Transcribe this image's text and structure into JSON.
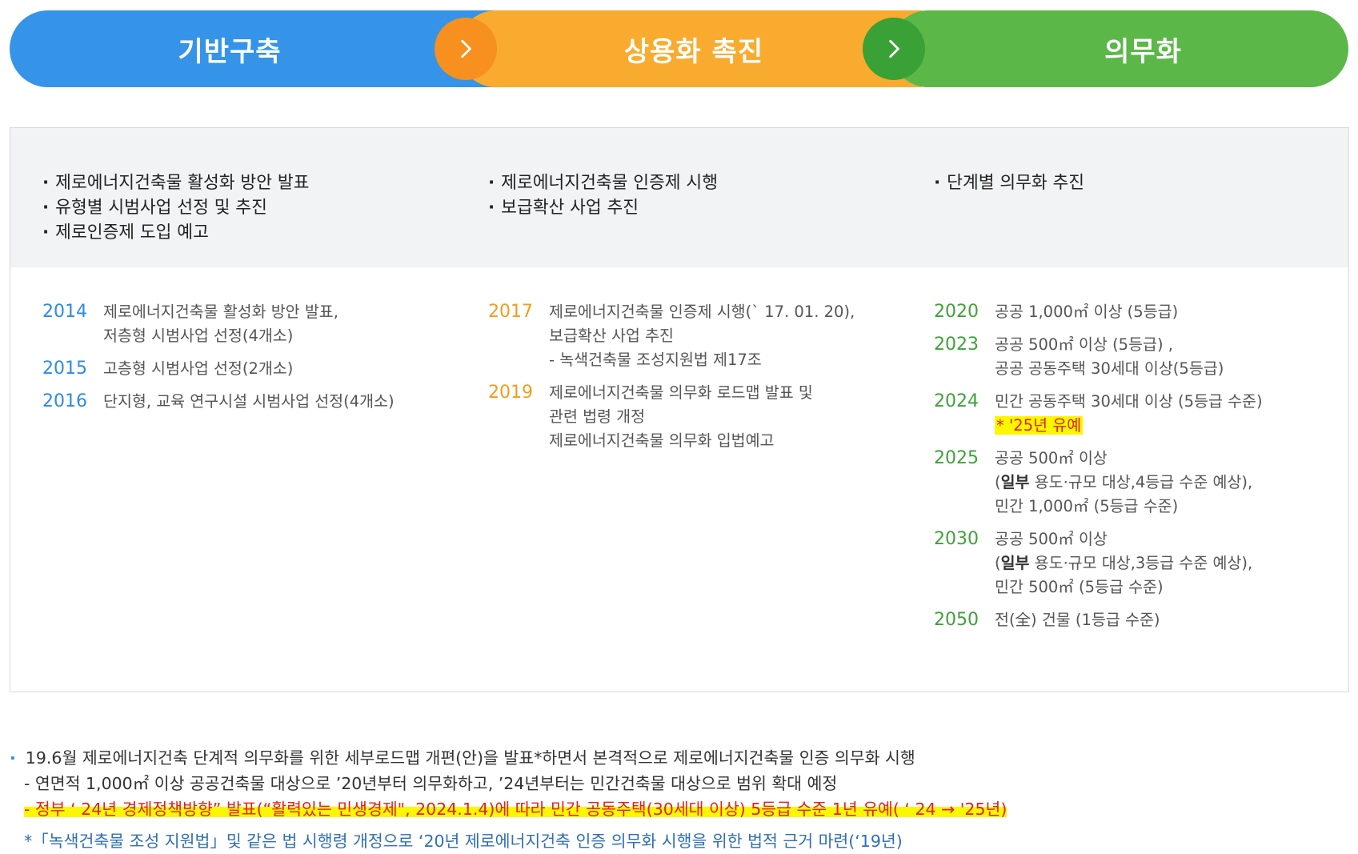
{
  "phases": [
    {
      "label": "기반구축",
      "color": "#3594e8"
    },
    {
      "label": "상용화 촉진",
      "color": "#f9ab2f"
    },
    {
      "label": "의무화",
      "color": "#5bb848"
    }
  ],
  "summary": {
    "col1": [
      "제로에너지건축물 활성화 방안 발표",
      "유형별 시범사업 선정 및 추진",
      "제로인증제 도입 예고"
    ],
    "col2": [
      "제로에너지건축물 인증제 시행",
      "보급확산 사업 추진"
    ],
    "col3": [
      "단계별 의무화 추진"
    ]
  },
  "timeline": {
    "col1": [
      {
        "year": "2014",
        "lines": [
          "제로에너지건축물 활성화 방안 발표,",
          "저층형 시범사업 선정(4개소)"
        ]
      },
      {
        "year": "2015",
        "lines": [
          "고층형 시범사업 선정(2개소)"
        ]
      },
      {
        "year": "2016",
        "lines": [
          "단지형, 교육 연구시설 시범사업 선정(4개소)"
        ]
      }
    ],
    "col2": [
      {
        "year": "2017",
        "lines": [
          "제로에너지건축물 인증제 시행(` 17. 01. 20),",
          "보급확산 사업 추진",
          "- 녹색건축물 조성지원법 제17조"
        ]
      },
      {
        "year": "2019",
        "lines": [
          "제로에너지건축물 의무화 로드맵 발표 및",
          "관련 법령 개정",
          "제로에너지건축물 의무화 입법예고"
        ]
      }
    ],
    "col3": [
      {
        "year": "2020",
        "lines": [
          "공공 1,000㎡ 이상 (5등급)"
        ]
      },
      {
        "year": "2023",
        "lines": [
          "공공 500㎡ 이상 (5등급) ,",
          "공공 공동주택 30세대 이상(5등급)"
        ]
      },
      {
        "year": "2024",
        "lines": [
          "민간 공동주택 30세대 이상 (5등급 수준)"
        ],
        "note": "* '25년 유예"
      },
      {
        "year": "2025",
        "lines": [
          "공공 500㎡ 이상"
        ],
        "bold": "일부",
        "rest": " 용도·규모 대상,4등급 수준 예상),",
        "last": "민간 1,000㎡ (5등급 수준)"
      },
      {
        "year": "2030",
        "lines": [
          "공공 500㎡ 이상"
        ],
        "bold": "일부",
        "rest": " 용도·규모 대상,3등급 수준 예상),",
        "last": "민간 500㎡ (5등급 수준)"
      },
      {
        "year": "2050",
        "lines": [
          "전(全) 건물 (1등급 수준)"
        ]
      }
    ]
  },
  "notes": {
    "main": "19.6월 제로에너지건축 단계적 의무화를 위한 세부로드맵 개편(안)을 발표*하면서 본격적으로 제로에너지건축물 인증 의무화 시행",
    "sub": "- 연면적 1,000㎡ 이상 공공건축물 대상으로 ’20년부터 의무화하고, ’24년부터는 민간건축물 대상으로 범위 확대 예정",
    "highlight": "- 정부 ‘ 24년 경제정책방향” 발표(“활력있는 민생경제\", 2024.1.4)에 따라 민간 공동주택(30세대 이상) 5등급 수준 1년 유예( ‘ 24 → '25년)",
    "reference": "*「녹색건축물 조성 지원법」및 같은 법 시행령 개정으로 ‘20년 제로에너지건축 인증 의무화 시행을 위한 법적 근거 마련(‘19년)"
  }
}
